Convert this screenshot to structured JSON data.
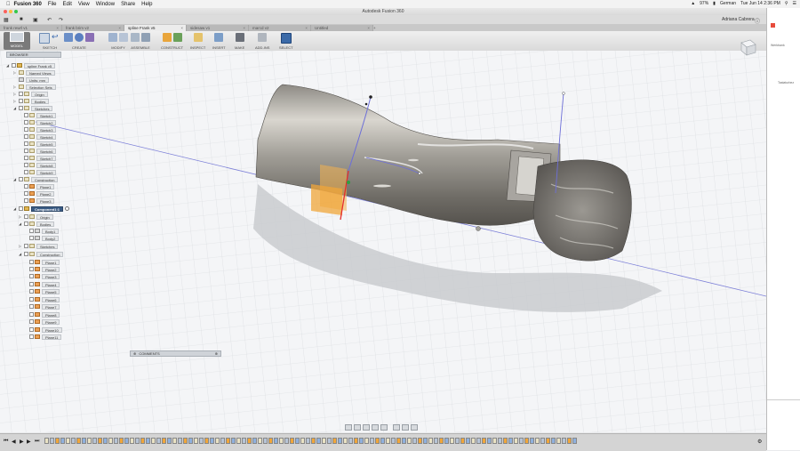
{
  "menubar": {
    "app_name": "Fusion 360",
    "items": [
      "File",
      "Edit",
      "View",
      "Window",
      "Share",
      "Help"
    ],
    "battery": "97%",
    "language": "German",
    "datetime": "Tue Jun 14  2:36 PM"
  },
  "window": {
    "title": "Autodesk Fusion 360"
  },
  "quick_toolbar": {
    "user": "Adriana Cabrera"
  },
  "tabs": [
    {
      "label": "frank rewrl v1",
      "active": false
    },
    {
      "label": "frank brim v2",
      "active": false
    },
    {
      "label": "spline Frank v5",
      "active": true
    },
    {
      "label": "sidesaw v1",
      "active": false
    },
    {
      "label": "marcd v2",
      "active": false
    },
    {
      "label": "Untitled",
      "active": false
    }
  ],
  "ribbon": {
    "workspace": "MODEL",
    "groups": [
      "SKETCH",
      "CREATE",
      "MODIFY",
      "ASSEMBLE",
      "CONSTRUCT",
      "INSPECT",
      "INSERT",
      "MAKE",
      "ADD-INS",
      "SELECT"
    ]
  },
  "browser": {
    "header": "BROWSER",
    "root": "spline Frank v5",
    "nodes": {
      "named_views": "Named Views",
      "units": "Units: mm",
      "selection_sets": "Selection Sets",
      "origin": "Origin",
      "bodies": "Bodies",
      "sketches": "Sketches",
      "sketch_items": [
        "Sketch1",
        "Sketch2",
        "Sketch3",
        "Sketch4",
        "Sketch5",
        "Sketch6",
        "Sketch7",
        "Sketch8",
        "Sketch9"
      ],
      "construction": "Construction",
      "plane_items": [
        "Plane1",
        "Plane2",
        "Plane3"
      ],
      "component": "Component1:1",
      "comp_origin": "Origin",
      "comp_bodies": "Bodies",
      "body_items": [
        "Body1",
        "Body2"
      ],
      "comp_sketches": "Sketches",
      "comp_construction": "Construction",
      "comp_plane_items": [
        "Plane1",
        "Plane2",
        "Plane3",
        "Plane4",
        "Plane5",
        "Plane6",
        "Plane7",
        "Plane8",
        "Plane9",
        "Plane10",
        "Plane11"
      ]
    }
  },
  "comments": {
    "label": "COMMENTS"
  },
  "side_panel": {
    "label1": "Werkbank",
    "label2": "Tastaturbez"
  },
  "colors": {
    "accent": "#3a5b84",
    "plane_orange": "#f0a63a",
    "axis_red": "#e52d2d",
    "axis_blue": "#6d6fd8"
  }
}
